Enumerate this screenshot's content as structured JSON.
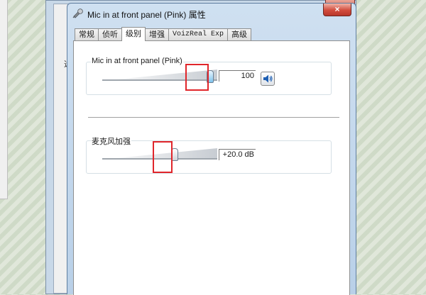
{
  "background_window": {
    "fragment_text": "选"
  },
  "dialog": {
    "title": "Mic in at front panel (Pink) 属性",
    "close_label": "×",
    "tabs": [
      {
        "label": "常规",
        "active": false
      },
      {
        "label": "侦听",
        "active": false
      },
      {
        "label": "级别",
        "active": true
      },
      {
        "label": "增强",
        "active": false
      },
      {
        "label": "VoizReal Exp",
        "active": false
      },
      {
        "label": "高级",
        "active": false
      }
    ]
  },
  "levels": {
    "microphone": {
      "label": "Mic in at front panel (Pink)",
      "value": "100",
      "slider_level": 1.0,
      "mute_icon": "speaker-icon"
    },
    "boost": {
      "label": "麦克风加强",
      "value": "+20.0 dB",
      "slider_level": 0.67
    }
  },
  "colors": {
    "highlight": "#e0262b",
    "title_bar": "#b9d0e8",
    "close_button": "#d24c3d"
  }
}
